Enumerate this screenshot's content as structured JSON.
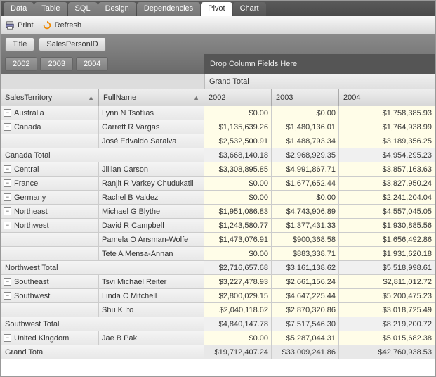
{
  "tabs": [
    "Data",
    "Table",
    "SQL",
    "Design",
    "Dependencies",
    "Pivot",
    "Chart"
  ],
  "activeTab": "Pivot",
  "toolbar": {
    "print": "Print",
    "refresh": "Refresh"
  },
  "filter": {
    "title": "Title",
    "field": "SalesPersonID"
  },
  "yearButtons": [
    "2002",
    "2003",
    "2004"
  ],
  "dropColText": "Drop Column Fields Here",
  "grandTotalLabel": "Grand Total",
  "rowHeaders": {
    "territory": "SalesTerritory",
    "fullname": "FullName"
  },
  "colHeaders": [
    "2002",
    "2003",
    "2004"
  ],
  "rows": [
    {
      "type": "data",
      "territory": "Australia",
      "name": "Lynn N Tsoflias",
      "v": [
        "$0.00",
        "$0.00",
        "$1,758,385.93"
      ]
    },
    {
      "type": "data",
      "territory": "Canada",
      "name": "Garrett R Vargas",
      "v": [
        "$1,135,639.26",
        "$1,480,136.01",
        "$1,764,938.99"
      ]
    },
    {
      "type": "data",
      "territory": "",
      "name": "José Edvaldo Saraiva",
      "v": [
        "$2,532,500.91",
        "$1,488,793.34",
        "$3,189,356.25"
      ]
    },
    {
      "type": "total",
      "label": "Canada Total",
      "v": [
        "$3,668,140.18",
        "$2,968,929.35",
        "$4,954,295.23"
      ]
    },
    {
      "type": "data",
      "territory": "Central",
      "name": "Jillian  Carson",
      "v": [
        "$3,308,895.85",
        "$4,991,867.71",
        "$3,857,163.63"
      ]
    },
    {
      "type": "data",
      "territory": "France",
      "name": "Ranjit R Varkey Chudukatil",
      "v": [
        "$0.00",
        "$1,677,652.44",
        "$3,827,950.24"
      ]
    },
    {
      "type": "data",
      "territory": "Germany",
      "name": "Rachel B Valdez",
      "v": [
        "$0.00",
        "$0.00",
        "$2,241,204.04"
      ]
    },
    {
      "type": "data",
      "territory": "Northeast",
      "name": "Michael G Blythe",
      "v": [
        "$1,951,086.83",
        "$4,743,906.89",
        "$4,557,045.05"
      ]
    },
    {
      "type": "data",
      "territory": "Northwest",
      "name": "David R Campbell",
      "v": [
        "$1,243,580.77",
        "$1,377,431.33",
        "$1,930,885.56"
      ]
    },
    {
      "type": "data",
      "territory": "",
      "name": "Pamela O Ansman-Wolfe",
      "v": [
        "$1,473,076.91",
        "$900,368.58",
        "$1,656,492.86"
      ]
    },
    {
      "type": "data",
      "territory": "",
      "name": "Tete A Mensa-Annan",
      "v": [
        "$0.00",
        "$883,338.71",
        "$1,931,620.18"
      ]
    },
    {
      "type": "total",
      "label": "Northwest Total",
      "v": [
        "$2,716,657.68",
        "$3,161,138.62",
        "$5,518,998.61"
      ]
    },
    {
      "type": "data",
      "territory": "Southeast",
      "name": "Tsvi Michael Reiter",
      "v": [
        "$3,227,478.93",
        "$2,661,156.24",
        "$2,811,012.72"
      ]
    },
    {
      "type": "data",
      "territory": "Southwest",
      "name": "Linda C Mitchell",
      "v": [
        "$2,800,029.15",
        "$4,647,225.44",
        "$5,200,475.23"
      ]
    },
    {
      "type": "data",
      "territory": "",
      "name": "Shu K Ito",
      "v": [
        "$2,040,118.62",
        "$2,870,320.86",
        "$3,018,725.49"
      ]
    },
    {
      "type": "total",
      "label": "Southwest Total",
      "v": [
        "$4,840,147.78",
        "$7,517,546.30",
        "$8,219,200.72"
      ]
    },
    {
      "type": "data",
      "territory": "United Kingdom",
      "name": "Jae B Pak",
      "v": [
        "$0.00",
        "$5,287,044.31",
        "$5,015,682.38"
      ]
    },
    {
      "type": "grand",
      "label": "Grand Total",
      "v": [
        "$19,712,407.24",
        "$33,009,241.86",
        "$42,760,938.53"
      ]
    }
  ],
  "icons": {
    "print": "print-icon",
    "refresh": "refresh-icon"
  }
}
